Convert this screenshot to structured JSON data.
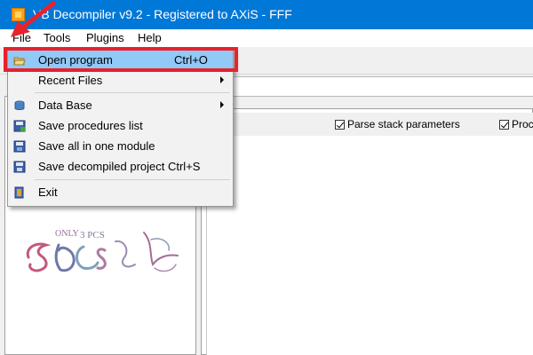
{
  "window": {
    "title": "VB Decompiler v9.2 - Registered to AXiS - FFF"
  },
  "menubar": {
    "items": [
      "File",
      "Tools",
      "Plugins",
      "Help"
    ]
  },
  "options": {
    "parse_stack": {
      "label": "Parse stack parameters",
      "checked": true
    },
    "procedure": {
      "label": "Proc",
      "checked": true
    }
  },
  "file_menu": {
    "open_program": {
      "label": "Open program",
      "shortcut": "Ctrl+O",
      "icon": "open-folder-icon"
    },
    "recent_files": {
      "label": "Recent Files",
      "submenu": true
    },
    "database": {
      "label": "Data Base",
      "submenu": true,
      "icon": "database-icon"
    },
    "save_procedures": {
      "label": "Save procedures list",
      "icon": "save-list-icon"
    },
    "save_all": {
      "label": "Save all in one module",
      "icon": "save-module-icon"
    },
    "save_project": {
      "label": "Save decompiled project Ctrl+S",
      "icon": "save-project-icon"
    },
    "exit": {
      "label": "Exit",
      "icon": "exit-icon"
    }
  },
  "colors": {
    "titlebar": "#0078d7",
    "highlight": "#91c9f7",
    "annotation": "#e8212b"
  }
}
